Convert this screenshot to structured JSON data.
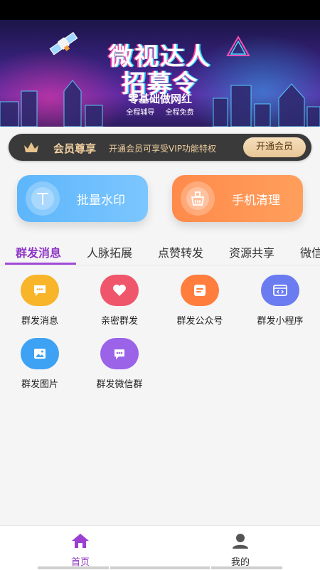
{
  "banner": {
    "title_line1": "微视达人",
    "title_line2": "招募令",
    "subtitle": "零基础做网红",
    "tags": [
      "全程辅导",
      "全程免费"
    ]
  },
  "vip": {
    "title": "会员尊享",
    "description": "开通会员可享受VIP功能特权",
    "button": "开通会员"
  },
  "features": [
    {
      "label": "批量水印",
      "icon": "text-watermark-icon",
      "color": "#5db6fb"
    },
    {
      "label": "手机清理",
      "icon": "broom-clean-icon",
      "color": "#ff8a4b"
    }
  ],
  "tabs": [
    "群发消息",
    "人脉拓展",
    "点赞转发",
    "资源共享",
    "微信"
  ],
  "active_tab": "群发消息",
  "grid": [
    {
      "label": "群发消息",
      "icon": "chat-bubble-icon",
      "color": "#f8b52a"
    },
    {
      "label": "亲密群发",
      "icon": "heart-icon",
      "color": "#f0566b"
    },
    {
      "label": "群发公众号",
      "icon": "article-icon",
      "color": "#ff7d3d"
    },
    {
      "label": "群发小程序",
      "icon": "mini-program-icon",
      "color": "#6a7cf0"
    },
    {
      "label": "群发图片",
      "icon": "image-icon",
      "color": "#3ea2f4"
    },
    {
      "label": "群发微信群",
      "icon": "group-chat-icon",
      "color": "#9a63e8"
    }
  ],
  "bottom_nav": [
    {
      "label": "首页",
      "icon": "home-icon",
      "active": true
    },
    {
      "label": "我的",
      "icon": "user-icon",
      "active": false
    }
  ],
  "colors": {
    "accent": "#8e36c5",
    "vip_gold": "#f0cf9e",
    "vip_bg": "#3a3a3a"
  }
}
